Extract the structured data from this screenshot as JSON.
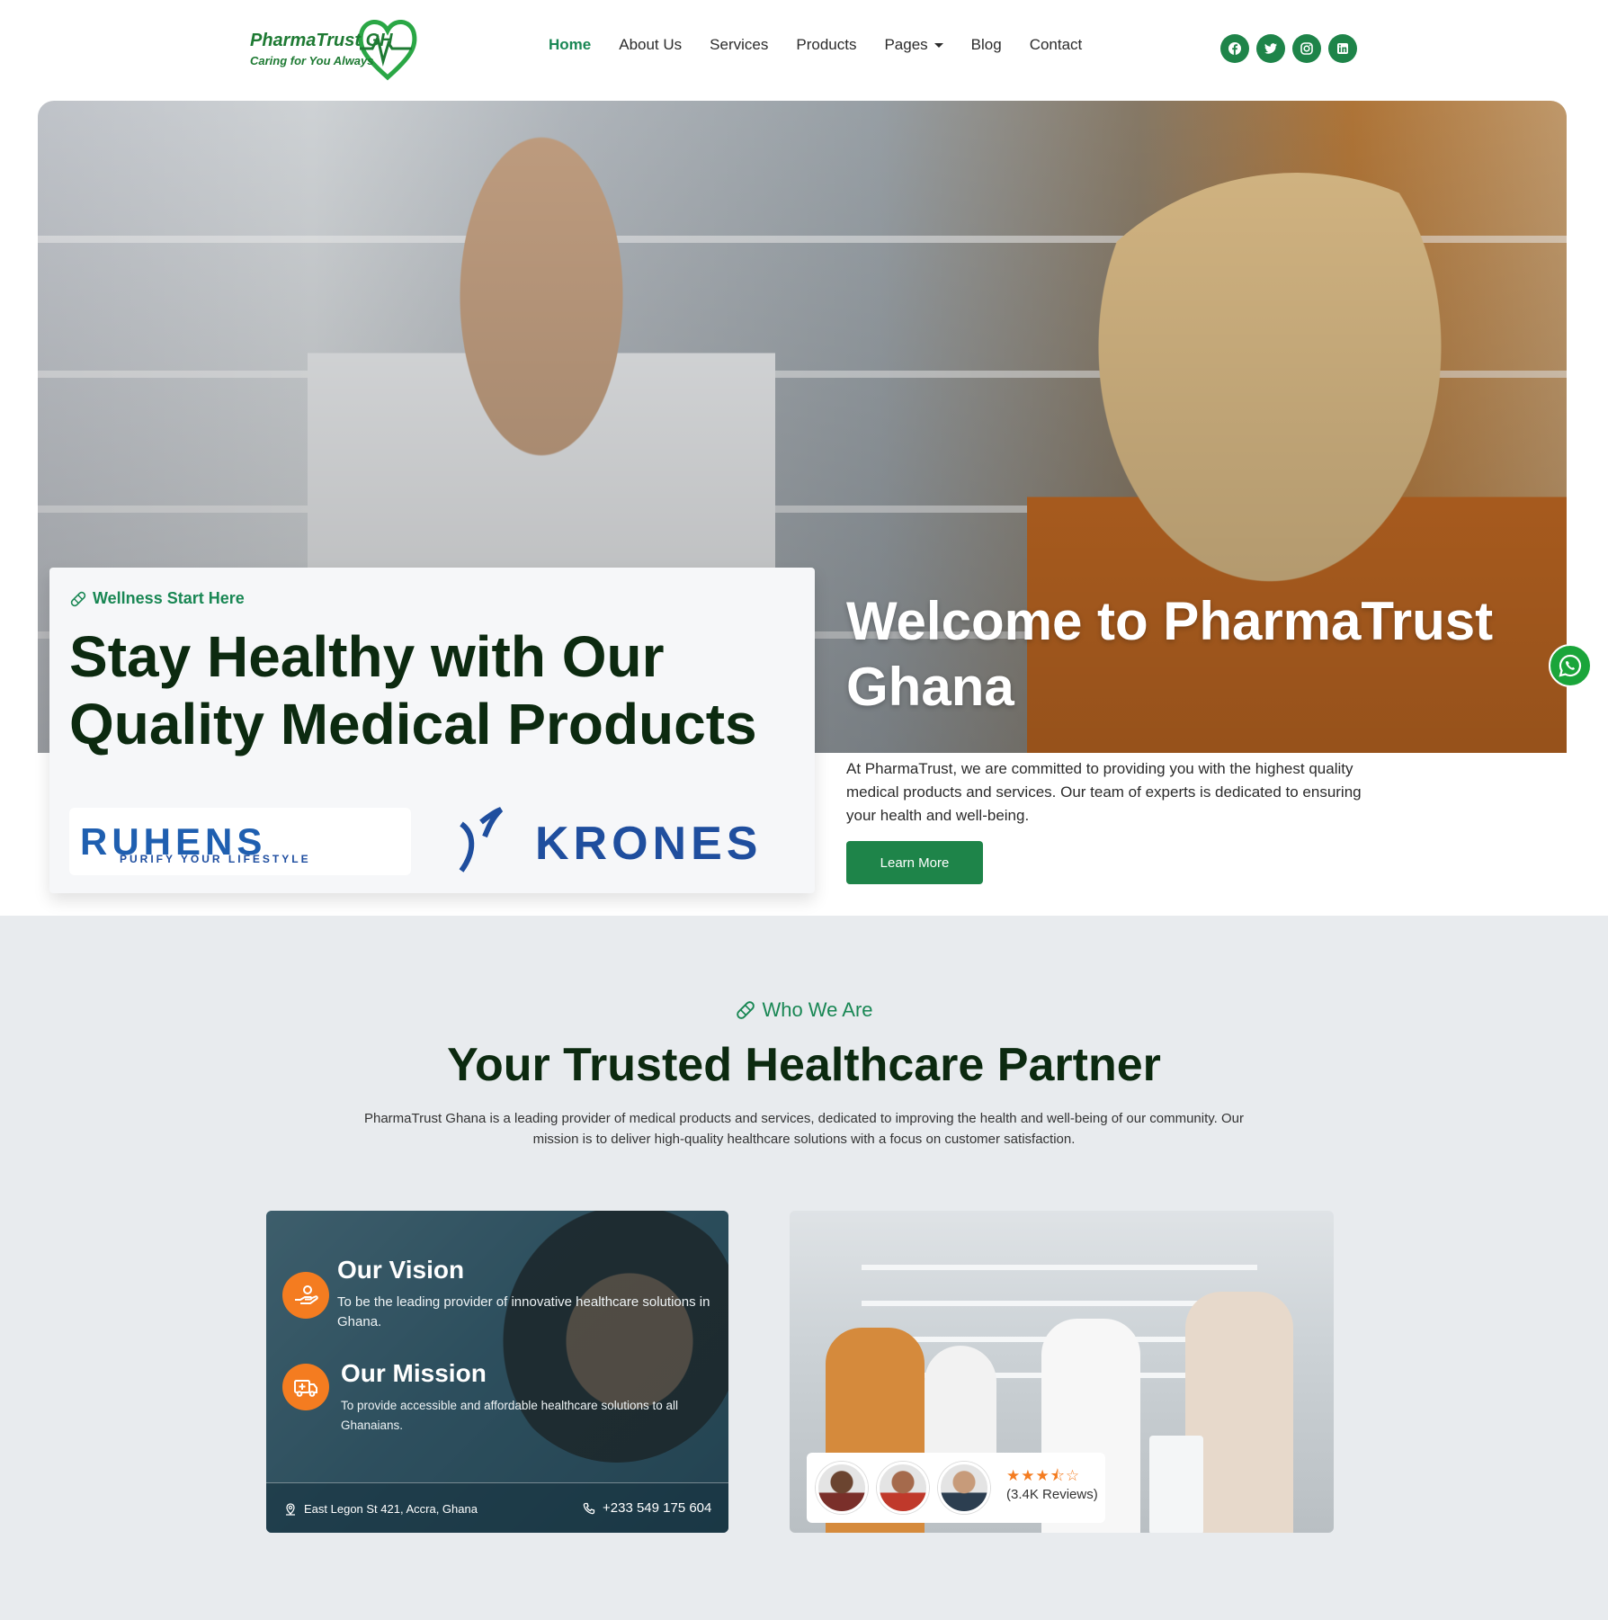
{
  "brand": {
    "name": "PharmaTrust GH",
    "tagline": "Caring for You Always",
    "accent_color": "#198754",
    "orange": "#f47c20"
  },
  "nav": {
    "items": [
      {
        "label": "Home",
        "active": true
      },
      {
        "label": "About Us"
      },
      {
        "label": "Services"
      },
      {
        "label": "Products"
      },
      {
        "label": "Pages",
        "dropdown": true
      },
      {
        "label": "Blog"
      },
      {
        "label": "Contact"
      }
    ],
    "socials": [
      "facebook-icon",
      "twitter-icon",
      "instagram-icon",
      "linkedin-icon"
    ]
  },
  "hero": {
    "eyebrow": "Wellness Start Here",
    "title": "Stay Healthy with Our Quality Medical Products",
    "partner_ruhens": "RUHENS",
    "partner_ruhens_tagline": "PURIFY YOUR LIFESTYLE",
    "partner_krones": "KRONES",
    "welcome": "Welcome to PharmaTrust Ghana",
    "description": "At PharmaTrust, we are committed to providing you with the highest quality medical products and services. Our team of experts is dedicated to ensuring your health and well-being.",
    "cta": "Learn More"
  },
  "about": {
    "eyebrow": "Who We Are",
    "title": "Your Trusted Healthcare Partner",
    "description": "PharmaTrust Ghana is a leading provider of medical products and services, dedicated to improving the health and well-being of our community. Our mission is to deliver high-quality healthcare solutions with a focus on customer satisfaction.",
    "vision_title": "Our Vision",
    "vision_text": "To be the leading provider of innovative healthcare solutions in Ghana.",
    "mission_title": "Our Mission",
    "mission_text": "To provide accessible and affordable healthcare solutions to all Ghanaians.",
    "address": "East Legon St 421, Accra, Ghana",
    "phone": "+233 549 175 604",
    "rating": 3.5,
    "rating_stars": "★★★⯪☆",
    "reviews": "(3.4K Reviews)"
  }
}
